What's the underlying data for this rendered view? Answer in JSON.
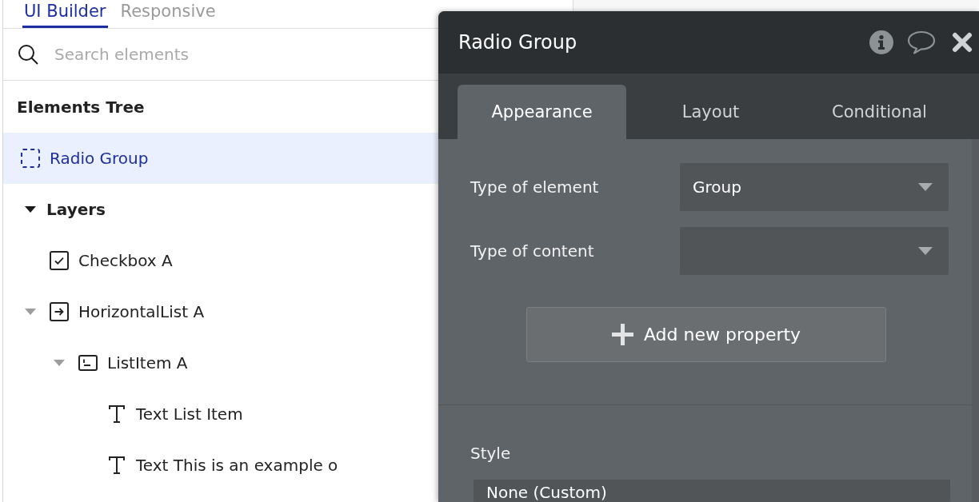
{
  "sidebar": {
    "tabs": [
      {
        "label": "UI Builder",
        "selected": true
      },
      {
        "label": "Responsive",
        "selected": false
      }
    ],
    "search": {
      "placeholder": "Search elements"
    },
    "tree_title": "Elements Tree",
    "root_element": {
      "label": "Radio Group",
      "kind": "group",
      "selected": true
    },
    "layers": {
      "label": "Layers",
      "expanded": true,
      "children": [
        {
          "label": "Checkbox A",
          "kind": "checkbox",
          "selected": false
        },
        {
          "label": "HorizontalList A",
          "kind": "horizontal-list",
          "selected": false,
          "expanded": true,
          "children": [
            {
              "label": "ListItem A",
              "kind": "list-item",
              "selected": false,
              "expanded": true,
              "children": [
                {
                  "label": "Text List Item",
                  "kind": "text",
                  "selected": false
                },
                {
                  "label": "Text This is an example o",
                  "kind": "text",
                  "selected": false
                }
              ]
            }
          ]
        }
      ]
    }
  },
  "property_editor": {
    "title": "Radio Group",
    "tabs": [
      {
        "label": "Appearance",
        "selected": true
      },
      {
        "label": "Layout",
        "selected": false
      },
      {
        "label": "Conditional",
        "selected": false
      }
    ],
    "fields": [
      {
        "label": "Type of element",
        "value": "Group"
      },
      {
        "label": "Type of content"
      }
    ],
    "add_property_button": "Add new property",
    "style": {
      "label": "Style",
      "value": "None (Custom)"
    }
  }
}
